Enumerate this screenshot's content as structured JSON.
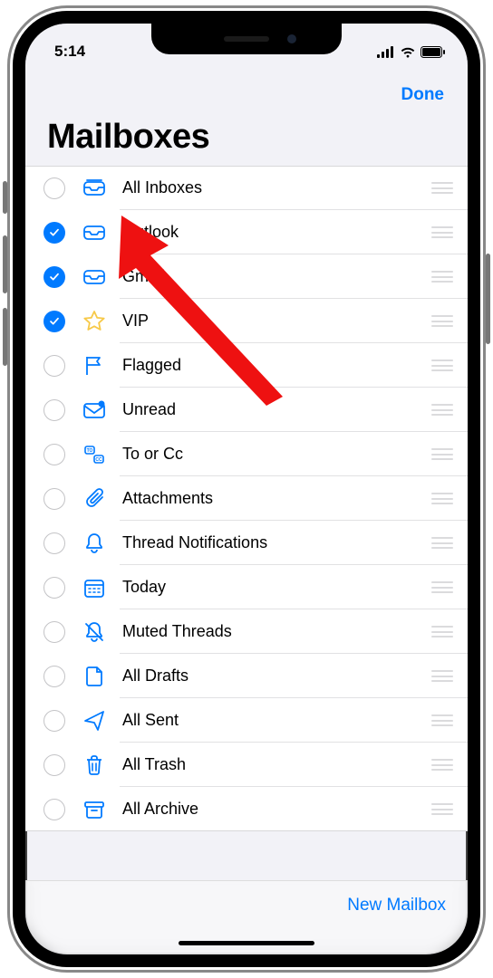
{
  "status": {
    "time": "5:14"
  },
  "header": {
    "done": "Done",
    "title": "Mailboxes"
  },
  "toolbar": {
    "new_mailbox": "New Mailbox"
  },
  "colors": {
    "accent": "#007aff",
    "star": "#f7c948"
  },
  "rows": [
    {
      "label": "All Inboxes",
      "checked": false,
      "icon": "all-inboxes-icon"
    },
    {
      "label": "Outlook",
      "checked": true,
      "icon": "inbox-icon"
    },
    {
      "label": "Gmail",
      "checked": true,
      "icon": "inbox-icon"
    },
    {
      "label": "VIP",
      "checked": true,
      "icon": "star-icon"
    },
    {
      "label": "Flagged",
      "checked": false,
      "icon": "flag-icon"
    },
    {
      "label": "Unread",
      "checked": false,
      "icon": "unread-icon"
    },
    {
      "label": "To or Cc",
      "checked": false,
      "icon": "to-cc-icon"
    },
    {
      "label": "Attachments",
      "checked": false,
      "icon": "attachment-icon"
    },
    {
      "label": "Thread Notifications",
      "checked": false,
      "icon": "bell-icon"
    },
    {
      "label": "Today",
      "checked": false,
      "icon": "calendar-icon"
    },
    {
      "label": "Muted Threads",
      "checked": false,
      "icon": "mute-icon"
    },
    {
      "label": "All Drafts",
      "checked": false,
      "icon": "draft-icon"
    },
    {
      "label": "All Sent",
      "checked": false,
      "icon": "sent-icon"
    },
    {
      "label": "All Trash",
      "checked": false,
      "icon": "trash-icon"
    },
    {
      "label": "All Archive",
      "checked": false,
      "icon": "archive-icon"
    }
  ]
}
